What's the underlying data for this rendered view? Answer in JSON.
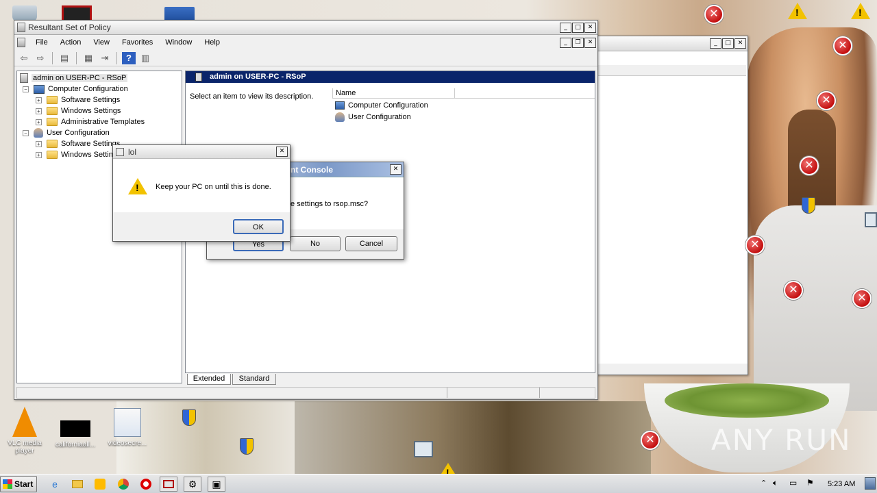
{
  "desktop": {
    "icons": [
      {
        "label": "VLC media player",
        "icon": "vlc-icon"
      },
      {
        "label": "californiaall...",
        "icon": "black-file-icon"
      },
      {
        "label": "videosecre...",
        "icon": "word-doc-warning-icon"
      }
    ],
    "watermark": "ANY RUN"
  },
  "main_window": {
    "title": "Resultant Set of Policy",
    "menus": [
      "File",
      "Action",
      "View",
      "Favorites",
      "Window",
      "Help"
    ],
    "tree": {
      "root": "admin on USER-PC - RSoP",
      "computer": "Computer Configuration",
      "computer_children": [
        "Software Settings",
        "Windows Settings",
        "Administrative Templates"
      ],
      "user": "User Configuration",
      "user_children": [
        "Software Settings",
        "Windows Settings"
      ]
    },
    "right_header": "admin on USER-PC - RSoP",
    "description": "Select an item to view its description.",
    "list_header": "Name",
    "list_items": [
      "Computer Configuration",
      "User Configuration"
    ],
    "tabs": [
      "Extended",
      "Standard"
    ]
  },
  "mmc_dialog": {
    "title_partial": "nt Console",
    "message_partial": "e settings to rsop.msc?",
    "buttons": {
      "yes": "Yes",
      "no": "No",
      "cancel": "Cancel"
    }
  },
  "lol_dialog": {
    "title": "lol",
    "message": "Keep your PC on until this is done.",
    "ok": "OK"
  },
  "taskbar": {
    "start": "Start",
    "clock": "5:23 AM"
  }
}
